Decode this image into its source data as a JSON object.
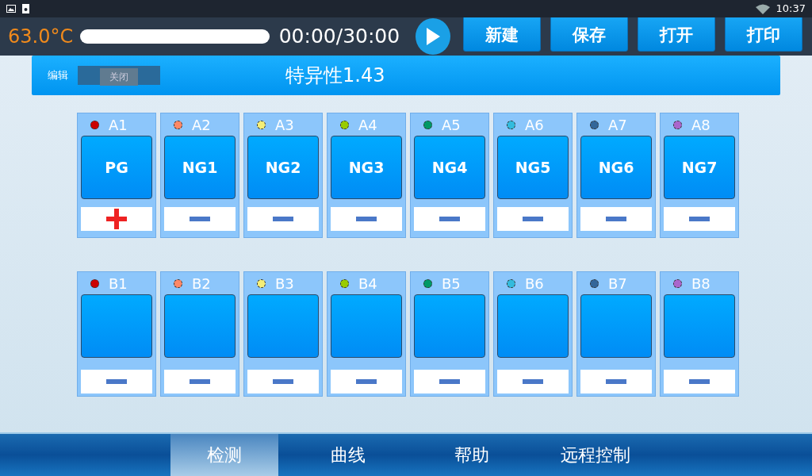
{
  "status_bar": {
    "time": "10:37"
  },
  "toolbar": {
    "temperature": "63.0°C",
    "progress": {
      "level": 0
    },
    "timer": "00:00/30:00",
    "buttons": [
      "新建",
      "保存",
      "打开",
      "打印"
    ]
  },
  "header": {
    "edit_label": "编辑",
    "edit_switch": {
      "text": "关闭",
      "on": false
    },
    "title": "特异性1.43"
  },
  "rows": [
    {
      "wells": [
        {
          "id": "A1",
          "color": "#cc0000",
          "label": "PG",
          "positive": true
        },
        {
          "id": "A2",
          "color": "#ff8866",
          "label": "NG1",
          "positive": false
        },
        {
          "id": "A3",
          "color": "#f5ee77",
          "label": "NG2",
          "positive": false
        },
        {
          "id": "A4",
          "color": "#99cc00",
          "label": "NG3",
          "positive": false
        },
        {
          "id": "A5",
          "color": "#009966",
          "label": "NG4",
          "positive": false
        },
        {
          "id": "A6",
          "color": "#33bbdd",
          "label": "NG5",
          "positive": false
        },
        {
          "id": "A7",
          "color": "#336699",
          "label": "NG6",
          "positive": false
        },
        {
          "id": "A8",
          "color": "#aa66cc",
          "label": "NG7",
          "positive": false
        }
      ]
    },
    {
      "wells": [
        {
          "id": "B1",
          "color": "#cc0000",
          "positive": false
        },
        {
          "id": "B2",
          "color": "#ff8866",
          "positive": false
        },
        {
          "id": "B3",
          "color": "#f5ee77",
          "positive": false
        },
        {
          "id": "B4",
          "color": "#99cc00",
          "positive": false
        },
        {
          "id": "B5",
          "color": "#009966",
          "positive": false
        },
        {
          "id": "B6",
          "color": "#33bbdd",
          "positive": false
        },
        {
          "id": "B7",
          "color": "#336699",
          "positive": false
        },
        {
          "id": "B8",
          "color": "#aa66cc",
          "positive": false
        }
      ]
    }
  ],
  "tabs": [
    {
      "label": "检测",
      "selected": true
    },
    {
      "label": "曲线",
      "selected": false
    },
    {
      "label": "帮助",
      "selected": false
    },
    {
      "label": "远程控制",
      "selected": false
    }
  ]
}
